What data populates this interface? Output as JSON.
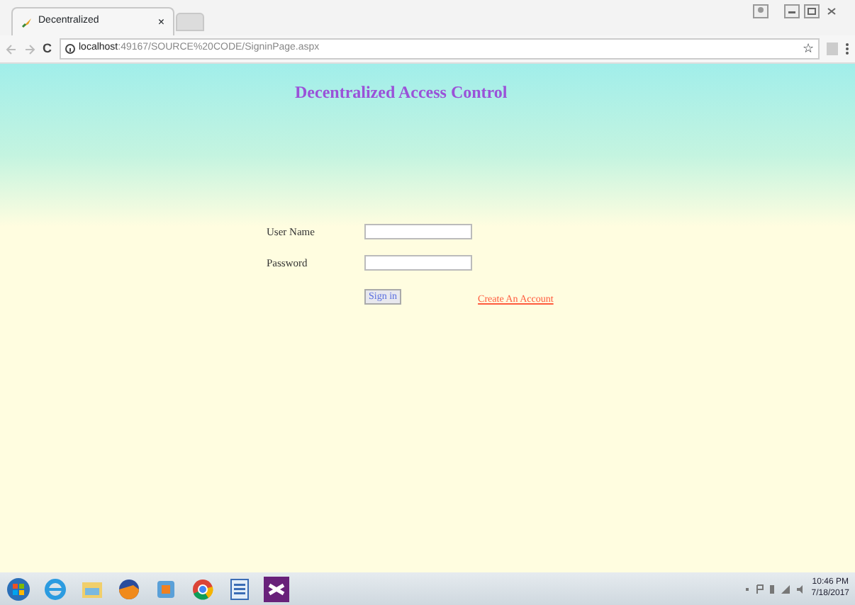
{
  "browser": {
    "tab_title": "Decentralized",
    "tab_close": "×",
    "url_host": "localhost",
    "url_rest": ":49167/SOURCE%20CODE/SigninPage.aspx",
    "reload": "C",
    "star": "☆"
  },
  "page": {
    "heading": "Decentralized Access Control",
    "fields": [
      {
        "label": "User Name"
      },
      {
        "label": "Password"
      }
    ],
    "sign_in": "Sign in",
    "create_account": "Create An Account"
  },
  "taskbar": {
    "time": "10:46 PM",
    "date": "7/18/2017"
  }
}
